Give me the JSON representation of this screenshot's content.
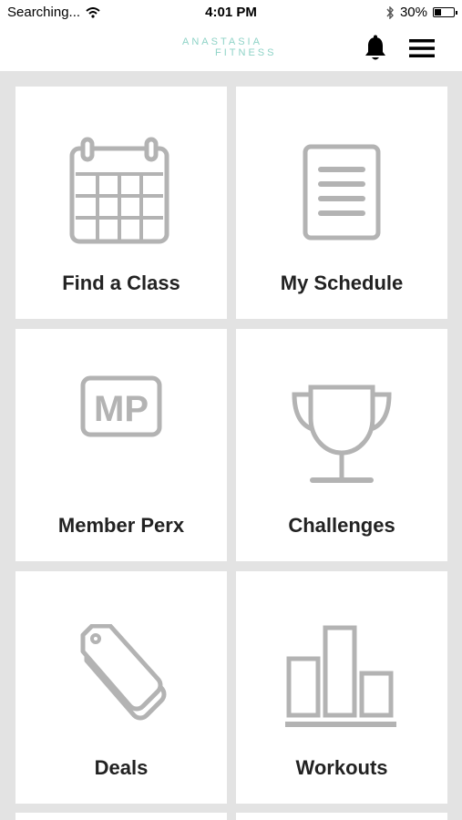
{
  "status_bar": {
    "carrier": "Searching...",
    "time": "4:01 PM",
    "battery": "30%",
    "battery_level": 0.3,
    "icons": [
      "wifi-icon",
      "bluetooth-icon",
      "battery-icon"
    ]
  },
  "header": {
    "logo_line1": "ANASTASIA",
    "logo_line2": "FITNESS",
    "icons": [
      "bell-icon",
      "hamburger-menu-icon"
    ]
  },
  "tiles": [
    {
      "label": "Find a Class",
      "icon": "calendar-icon"
    },
    {
      "label": "My Schedule",
      "icon": "document-list-icon"
    },
    {
      "label": "Member Perx",
      "icon": "mp-badge-icon",
      "icon_text": "MP"
    },
    {
      "label": "Challenges",
      "icon": "trophy-icon"
    },
    {
      "label": "Deals",
      "icon": "price-tag-icon"
    },
    {
      "label": "Workouts",
      "icon": "bar-chart-icon"
    }
  ],
  "colors": {
    "background": "#e3e3e3",
    "tile": "#ffffff",
    "icon_gray": "#b3b3b3",
    "logo_teal": "#8fd3c7"
  }
}
